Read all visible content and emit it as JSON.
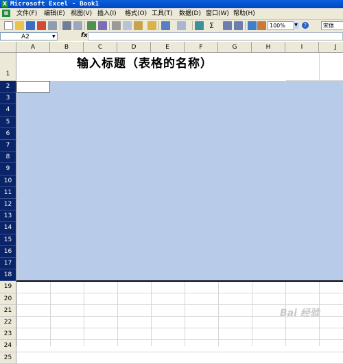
{
  "window": {
    "title": "Microsoft Excel - Book1",
    "app_icon": "excel-icon"
  },
  "menu": {
    "items": [
      "文件(F)",
      "编辑(E)",
      "视图(V)",
      "插入(I)",
      "格式(O)",
      "工具(T)",
      "数据(D)",
      "窗口(W)",
      "帮助(H)"
    ]
  },
  "toolbar": {
    "zoom": "100%",
    "font": "宋体",
    "help_glyph": "?"
  },
  "formula_bar": {
    "name_box": "A2",
    "fx": "fx",
    "content": ""
  },
  "sheet": {
    "columns": [
      "A",
      "B",
      "C",
      "D",
      "E",
      "F",
      "G",
      "H",
      "I",
      "J"
    ],
    "rows": [
      "1",
      "2",
      "3",
      "4",
      "5",
      "6",
      "7",
      "8",
      "9",
      "10",
      "11",
      "12",
      "13",
      "14",
      "15",
      "16",
      "17",
      "18",
      "19",
      "20",
      "21",
      "22",
      "23",
      "24",
      "25"
    ],
    "title_text": "输入标题（表格的名称）",
    "selected_rows": [
      "2",
      "3",
      "4",
      "5",
      "6",
      "7",
      "8",
      "9",
      "10",
      "11",
      "12",
      "13",
      "14",
      "15",
      "16",
      "17",
      "18"
    ],
    "active_cell": "A2",
    "selection_color": "#b8cbe9",
    "header_selected_color": "#0a246a"
  },
  "watermark": {
    "text": "Bai 经验"
  }
}
